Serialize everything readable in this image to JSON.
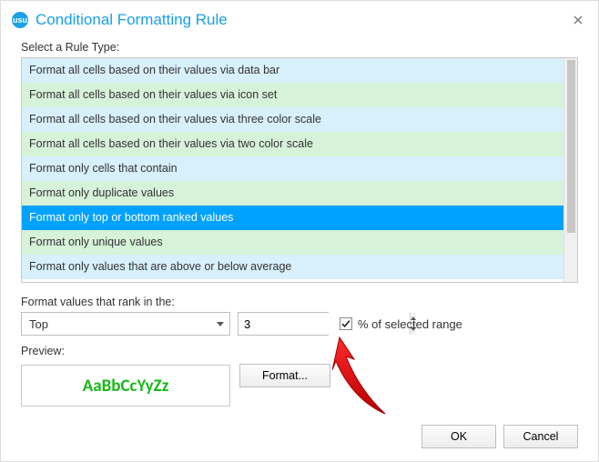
{
  "window": {
    "title": "Conditional Formatting Rule",
    "app_badge": "usu"
  },
  "rule_type": {
    "label": "Select a Rule Type:",
    "items": [
      "Format all cells based on their values via data bar",
      "Format all cells based on their values via icon set",
      "Format all cells based on their values via three color scale",
      "Format all cells based on their values via two color scale",
      "Format only cells that contain",
      "Format only duplicate values",
      "Format only top or bottom ranked values",
      "Format only unique values",
      "Format only values that are above or below average"
    ],
    "selected_index": 6
  },
  "rank": {
    "label": "Format values that rank in the:",
    "direction": "Top",
    "count": "3",
    "percent_label": "% of selected range",
    "percent_checked": true
  },
  "preview": {
    "label": "Preview:",
    "sample": "AaBbCcYyZz",
    "format_button": "Format..."
  },
  "buttons": {
    "ok": "OK",
    "cancel": "Cancel"
  }
}
